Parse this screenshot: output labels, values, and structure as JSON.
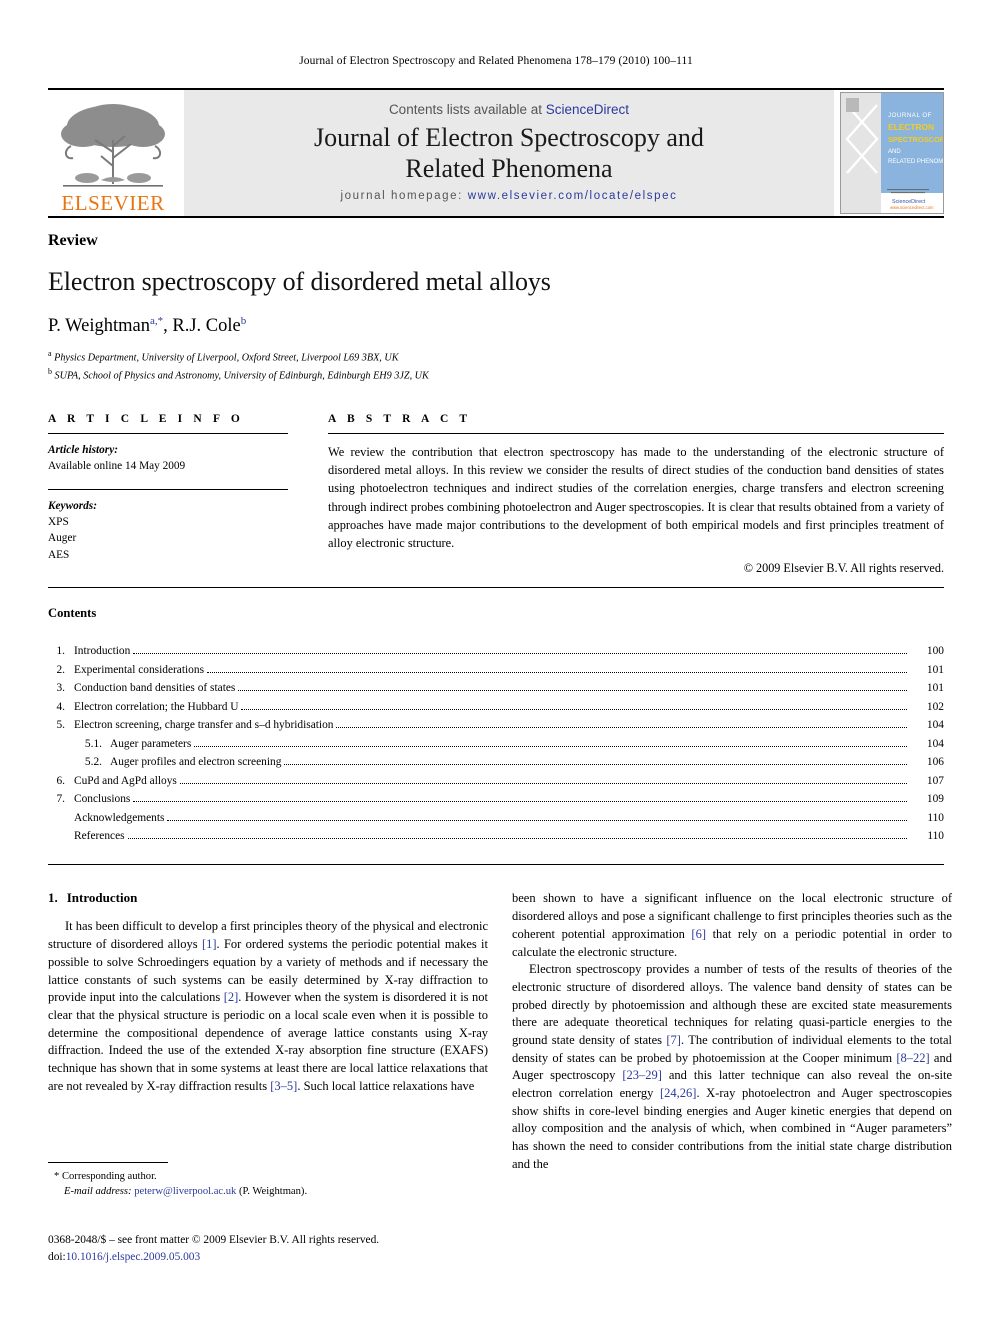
{
  "running_head": "Journal of Electron Spectroscopy and Related Phenomena 178–179 (2010) 100–111",
  "masthead": {
    "publisher_word": "ELSEVIER",
    "publisher_logo_name": "elsevier-tree-logo",
    "contents_prefix": "Contents lists available at ",
    "sciencedirect": "ScienceDirect",
    "journal_title_line1": "Journal of Electron Spectroscopy and",
    "journal_title_line2": "Related Phenomena",
    "homepage_label": "journal homepage: ",
    "homepage_url": "www.elsevier.com/locate/elspec",
    "cover": {
      "line1": "JOURNAL OF",
      "line2": "ELECTRON",
      "line3": "SPECTROSCOPY",
      "line4": "AND",
      "line5": "RELATED PHENOMENA",
      "footer1": "ScienceDirect",
      "footer2": "www.sciencedirect.com",
      "panel_color": "#8ab4dd",
      "highlight_color": "#f2cc22"
    }
  },
  "article": {
    "doc_type": "Review",
    "title": "Electron spectroscopy of disordered metal alloys",
    "authors_html": "P. Weightman<sup>a,*</sup>, R.J. Cole<sup>b</sup>",
    "affiliations": [
      {
        "marker": "a",
        "text": "Physics Department, University of Liverpool, Oxford Street, Liverpool L69 3BX, UK"
      },
      {
        "marker": "b",
        "text": "SUPA, School of Physics and Astronomy, University of Edinburgh, Edinburgh EH9 3JZ, UK"
      }
    ]
  },
  "info": {
    "heading": "A R T I C L E    I N F O",
    "history_label": "Article history:",
    "history_value": "Available online 14 May 2009",
    "keywords_label": "Keywords:",
    "keywords": [
      "XPS",
      "Auger",
      "AES"
    ]
  },
  "abstract": {
    "heading": "A B S T R A C T",
    "body": "We review the contribution that electron spectroscopy has made to the understanding of the electronic structure of disordered metal alloys. In this review we consider the results of direct studies of the conduction band densities of states using photoelectron techniques and indirect studies of the correlation energies, charge transfers and electron screening through indirect probes combining photoelectron and Auger spectroscopies. It is clear that results obtained from a variety of approaches have made major contributions to the development of both empirical models and first principles treatment of alloy electronic structure.",
    "copyright": "© 2009 Elsevier B.V. All rights reserved."
  },
  "contents": {
    "heading": "Contents",
    "items": [
      {
        "num": "1.",
        "label": "Introduction",
        "page": "100",
        "sub": false
      },
      {
        "num": "2.",
        "label": "Experimental considerations",
        "page": "101",
        "sub": false
      },
      {
        "num": "3.",
        "label": "Conduction band densities of states",
        "page": "101",
        "sub": false
      },
      {
        "num": "4.",
        "label": "Electron correlation; the Hubbard U",
        "page": "102",
        "sub": false
      },
      {
        "num": "5.",
        "label": "Electron screening, charge transfer and s–d hybridisation",
        "page": "104",
        "sub": false
      },
      {
        "num": "5.1.",
        "label": "Auger parameters",
        "page": "104",
        "sub": true
      },
      {
        "num": "5.2.",
        "label": "Auger profiles and electron screening",
        "page": "106",
        "sub": true
      },
      {
        "num": "6.",
        "label": "CuPd and AgPd alloys",
        "page": "107",
        "sub": false
      },
      {
        "num": "7.",
        "label": "Conclusions",
        "page": "109",
        "sub": false
      },
      {
        "num": "",
        "label": "Acknowledgements",
        "page": "110",
        "sub": false
      },
      {
        "num": "",
        "label": "References",
        "page": "110",
        "sub": false
      }
    ]
  },
  "body": {
    "section_number": "1.",
    "section_title": "Introduction",
    "left_paragraph_1_a": "It has been difficult to develop a first principles theory of the physical and electronic structure of disordered alloys ",
    "left_ref_1": "[1]",
    "left_paragraph_1_b": ". For ordered systems the periodic potential makes it possible to solve Schroedingers equation by a variety of methods and if necessary the lattice constants of such systems can be easily determined by X-ray diffraction to provide input into the calculations ",
    "left_ref_2": "[2]",
    "left_paragraph_1_c": ". However when the system is disordered it is not clear that the physical structure is periodic on a local scale even when it is possible to determine the compositional dependence of average lattice constants using X-ray diffraction. Indeed the use of the extended X-ray absorption fine structure (EXAFS) technique has shown that in some systems at least there are local lattice relaxations that are not revealed by X-ray diffraction results ",
    "left_ref_3": "[3–5]",
    "left_paragraph_1_d": ". Such local lattice relaxations have ",
    "right_paragraph_1_a": "been shown to have a significant influence on the local electronic structure of disordered alloys and pose a significant challenge to first principles theories such as the coherent potential approximation ",
    "right_ref_6": "[6]",
    "right_paragraph_1_b": " that rely on a periodic potential in order to calculate the electronic structure.",
    "right_paragraph_2_a": "Electron spectroscopy provides a number of tests of the results of theories of the electronic structure of disordered alloys. The valence band density of states can be probed directly by photoemission and although these are excited state measurements there are adequate theoretical techniques for relating quasi-particle energies to the ground state density of states ",
    "right_ref_7": "[7]",
    "right_paragraph_2_b": ". The contribution of individual elements to the total density of states can be probed by photoemission at the Cooper minimum ",
    "right_ref_8": "[8–22]",
    "right_paragraph_2_c": " and Auger spectroscopy ",
    "right_ref_23": "[23–29]",
    "right_paragraph_2_d": " and this latter technique can also reveal the on-site electron correlation energy ",
    "right_ref_24": "[24,26]",
    "right_paragraph_2_e": ". X-ray photoelectron and Auger spectroscopies show shifts in core-level binding energies and Auger kinetic energies that depend on alloy composition and the analysis of which, when combined in “Auger parameters” has shown the need to consider contributions from the initial state charge distribution and the"
  },
  "footnote": {
    "corresponding": "* Corresponding author.",
    "email_label": "E-mail address: ",
    "email": "peterw@liverpool.ac.uk",
    "email_suffix": " (P. Weightman)."
  },
  "imprint": {
    "line1": "0368-2048/$ – see front matter © 2009 Elsevier B.V. All rights reserved.",
    "doi_label": "doi:",
    "doi_value": "10.1016/j.elspec.2009.05.003"
  }
}
